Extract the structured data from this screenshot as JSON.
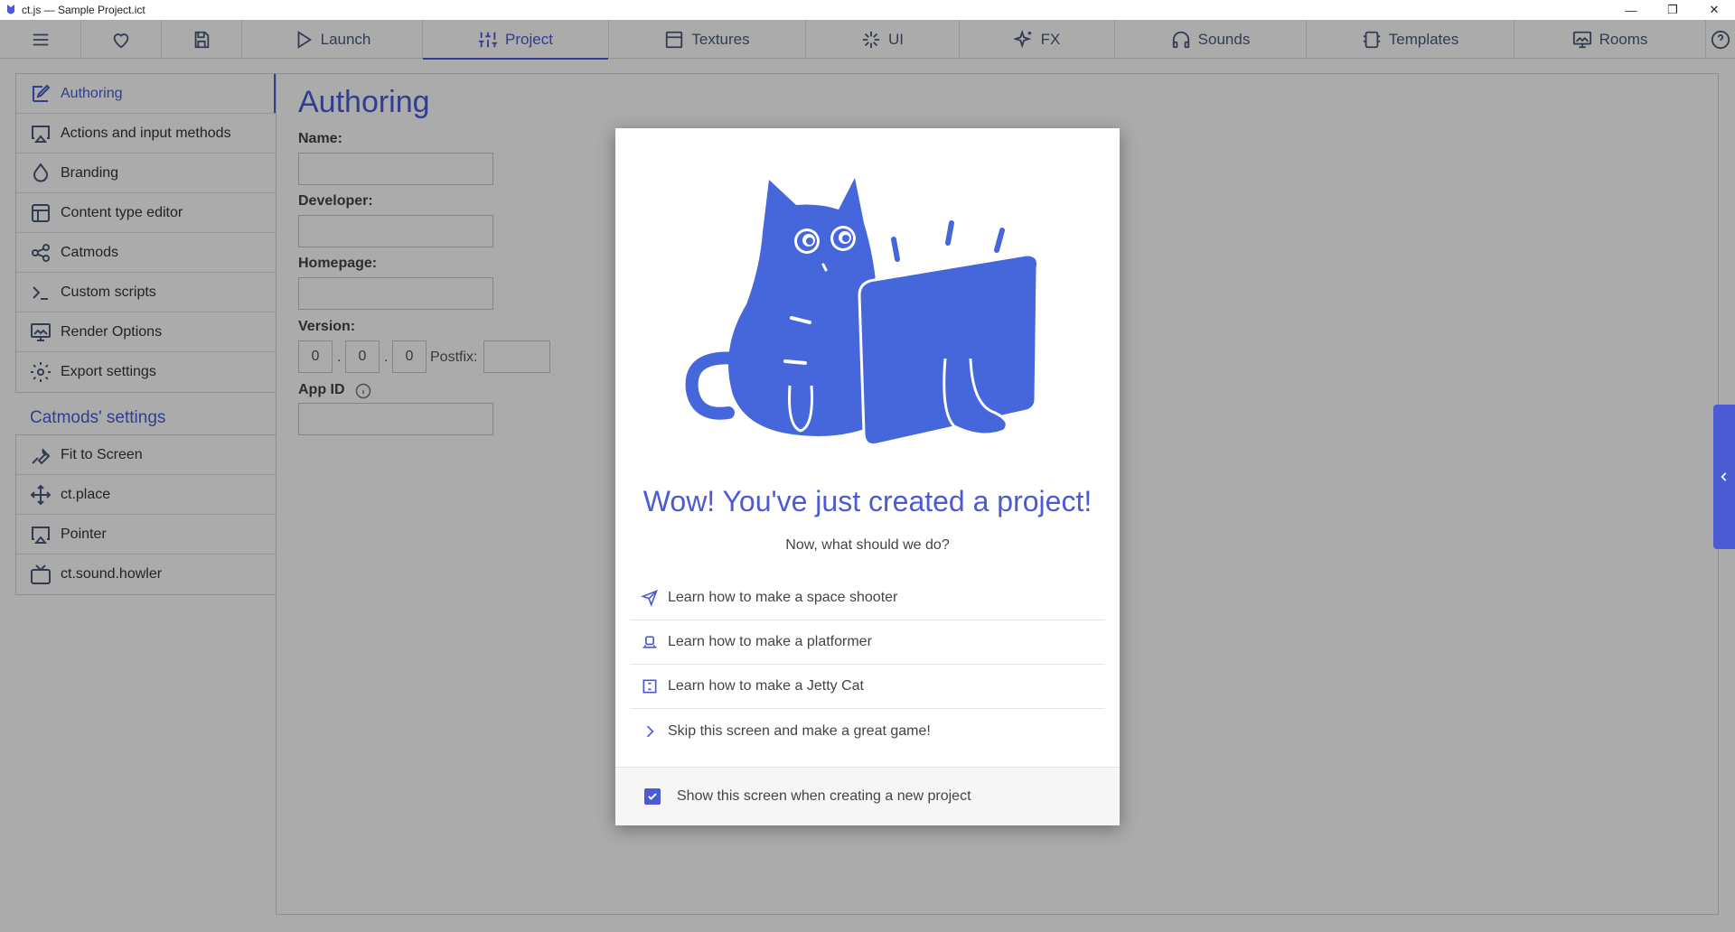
{
  "window": {
    "title": "ct.js — Sample Project.ict",
    "minimize": "—",
    "restore": "❐",
    "close": "✕"
  },
  "tabs": [
    {
      "label": "",
      "icon": "menu-icon"
    },
    {
      "label": "",
      "icon": "heart-icon"
    },
    {
      "label": "",
      "icon": "save-icon"
    },
    {
      "label": "Launch",
      "icon": "play-icon"
    },
    {
      "label": "Project",
      "icon": "sliders-icon",
      "active": true
    },
    {
      "label": "Textures",
      "icon": "image-icon"
    },
    {
      "label": "UI",
      "icon": "ui-icon"
    },
    {
      "label": "FX",
      "icon": "sparkles-icon"
    },
    {
      "label": "Sounds",
      "icon": "headphones-icon"
    },
    {
      "label": "Templates",
      "icon": "templates-icon"
    },
    {
      "label": "Rooms",
      "icon": "room-icon"
    },
    {
      "label": "",
      "icon": "help-icon"
    }
  ],
  "sidebar": {
    "items": [
      {
        "label": "Authoring",
        "icon": "edit-icon"
      },
      {
        "label": "Actions and input methods",
        "icon": "airplay-icon"
      },
      {
        "label": "Branding",
        "icon": "droplet-icon"
      },
      {
        "label": "Content type editor",
        "icon": "table-icon"
      },
      {
        "label": "Catmods",
        "icon": "catmods-icon"
      },
      {
        "label": "Custom scripts",
        "icon": "terminal-icon"
      },
      {
        "label": "Render Options",
        "icon": "monitor-icon"
      },
      {
        "label": "Export settings",
        "icon": "settings-icon"
      }
    ],
    "catmods_heading": "Catmods' settings",
    "catmods": [
      {
        "label": "Fit to Screen",
        "icon": "wrench-icon"
      },
      {
        "label": "ct.place",
        "icon": "move-icon"
      },
      {
        "label": "Pointer",
        "icon": "pointer-icon"
      },
      {
        "label": "ct.sound.howler",
        "icon": "tv-icon"
      }
    ]
  },
  "authoring": {
    "title": "Authoring",
    "name_label": "Name:",
    "developer_label": "Developer:",
    "homepage_label": "Homepage:",
    "version_label": "Version:",
    "version": [
      "0",
      "0",
      "0"
    ],
    "dot": ".",
    "postfix_label": "Postfix:",
    "appid_label": "App ID"
  },
  "modal": {
    "title": "Wow! You've just created a project!",
    "subtitle": "Now, what should we do?",
    "options": [
      {
        "label": "Learn how to make a space shooter",
        "icon": "send-icon"
      },
      {
        "label": "Learn how to make a platformer",
        "icon": "platformer-icon"
      },
      {
        "label": "Learn how to make a Jetty Cat",
        "icon": "jettycat-icon"
      },
      {
        "label": "Skip this screen and make a great game!",
        "icon": "chevron-right-icon"
      }
    ],
    "footer_checkbox_label": "Show this screen when creating a new project",
    "footer_checked": true
  },
  "colors": {
    "accent": "#4a5bd4",
    "cat": "#4567db",
    "overlay": "rgba(0,0,0,0.33)"
  }
}
